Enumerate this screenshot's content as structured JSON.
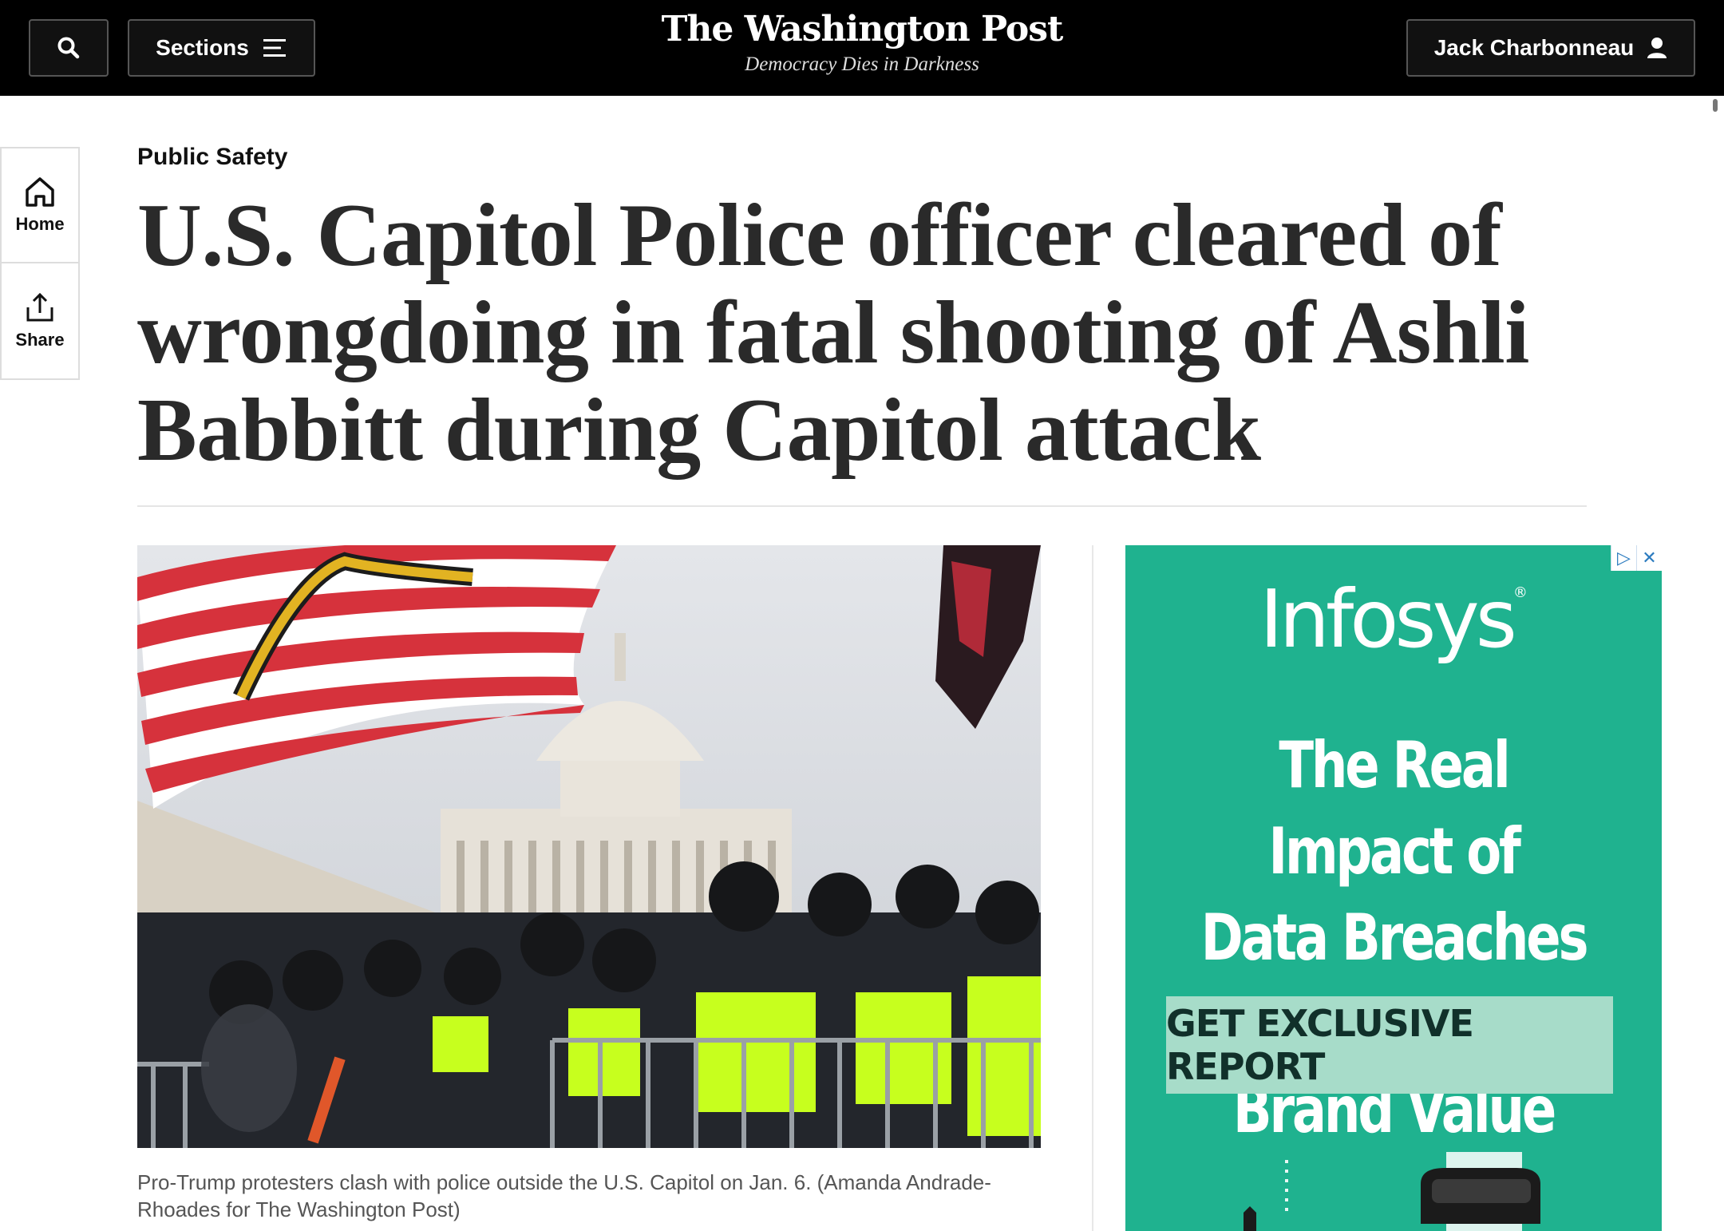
{
  "header": {
    "search_icon": "search-icon",
    "sections_label": "Sections",
    "sections_icon": "menu-icon",
    "logo_name": "The Washington Post",
    "logo_tagline": "Democracy Dies in Darkness",
    "user_name": "Jack Charbonneau",
    "user_icon": "user-icon"
  },
  "rail": {
    "home_label": "Home",
    "home_icon": "home-icon",
    "share_label": "Share",
    "share_icon": "share-icon"
  },
  "article": {
    "kicker": "Public Safety",
    "headline": "U.S. Capitol Police officer cleared of wrongdoing in fatal shooting of Ashli Babbitt during Capitol attack",
    "photo_caption": "Pro-Trump protesters clash with police outside the U.S. Capitol on Jan. 6. (Amanda Andrade-Rhoades for The Washington Post)"
  },
  "ad": {
    "brand": "Infosys",
    "brand_mark": "®",
    "headline_line1": "The Real Impact of",
    "headline_line2": "Data Breaches on",
    "headline_line3": "Brand Value",
    "cta": "GET EXCLUSIVE REPORT",
    "adchoices_icon": "adchoices-icon",
    "close_icon": "close-icon",
    "background_color": "#1fb28f"
  },
  "colors": {
    "masthead": "#000000",
    "headline_text": "#2a2a2a",
    "caption_text": "#555555"
  }
}
